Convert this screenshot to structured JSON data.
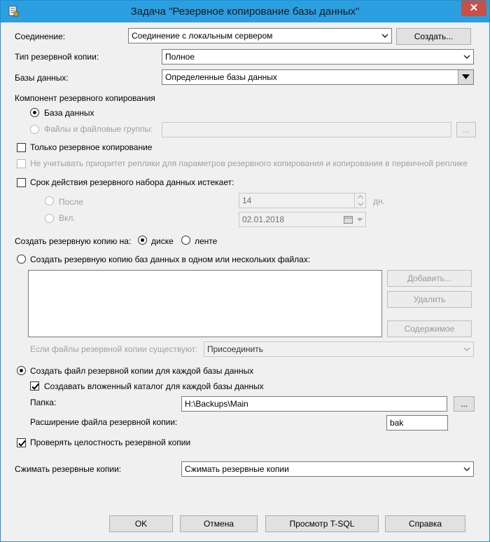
{
  "window": {
    "title": "Задача \"Резервное копирование базы данных\"",
    "close": "✕"
  },
  "connection": {
    "label": "Соединение:",
    "value": "Соединение с локальным сервером",
    "create_button": "Создать..."
  },
  "backup_type": {
    "label": "Тип резервной копии:",
    "value": "Полное"
  },
  "databases": {
    "label": "Базы данных:",
    "value": "Определенные базы данных"
  },
  "component": {
    "heading": "Компонент резервного копирования",
    "option_db": "База данных",
    "option_files": "Файлы и файловые группы:",
    "files_browse": "..."
  },
  "copy_only": {
    "label": "Только резервное копирование"
  },
  "replica": {
    "label": "Не учитывать приоритет реплики для параметров резервного копирования и копирования в первичной реплике"
  },
  "expiry": {
    "label": "Срок действия резервного набора данных истекает:",
    "after_label": "После",
    "after_value": "14",
    "days_label": "дн.",
    "on_label": "Вкл.",
    "on_value": "02.01.2018"
  },
  "destination": {
    "label": "Создать резервную копию на:",
    "disk": "диске",
    "tape": "ленте"
  },
  "single_files": {
    "label": "Создать резервную копию баз данных в одном или нескольких файлах:",
    "add": "Добавить...",
    "remove": "Удалить",
    "contents": "Содержимое",
    "exists_label": "Если файлы резервной копии существуют:",
    "exists_value": "Присоединить"
  },
  "per_db": {
    "label": "Создать файл резервной копии для каждой базы данных",
    "subdir_label": "Создавать вложенный каталог для каждой базы данных",
    "folder_label": "Папка:",
    "folder_value": "H:\\Backups\\Main",
    "folder_browse": "...",
    "ext_label": "Расширение файла резервной копии:",
    "ext_value": "bak"
  },
  "verify": {
    "label": "Проверять целостность резервной копии"
  },
  "compression": {
    "label": "Сжимать резервные копии:",
    "value": "Сжимать резервные копии"
  },
  "footer": {
    "ok": "OK",
    "cancel": "Отмена",
    "tsql": "Просмотр T-SQL",
    "help": "Справка"
  }
}
